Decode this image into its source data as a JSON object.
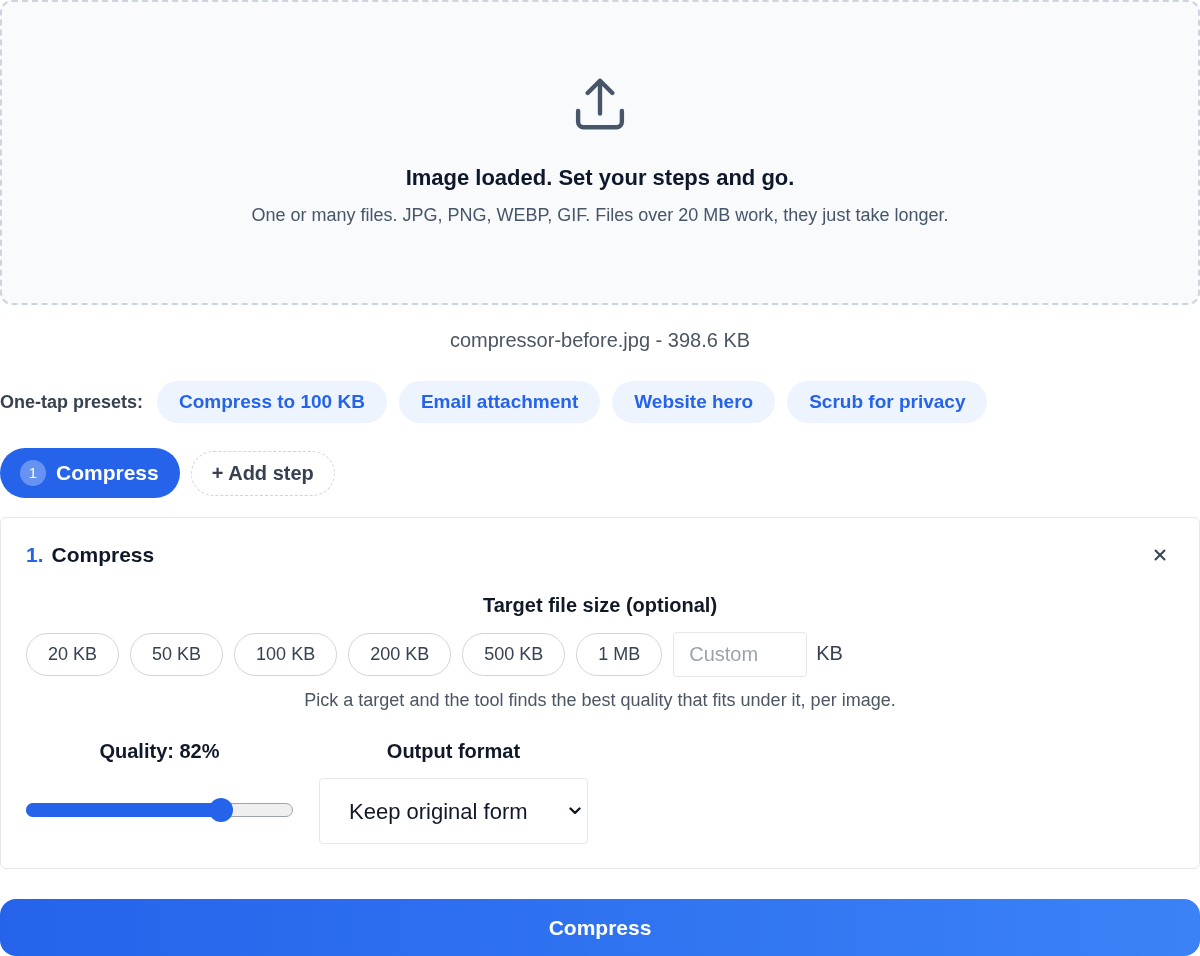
{
  "dropzone": {
    "title": "Image loaded. Set your steps and go.",
    "subtitle": "One or many files. JPG, PNG, WEBP, GIF. Files over 20 MB work, they just take longer."
  },
  "file_info": "compressor-before.jpg - 398.6 KB",
  "presets": {
    "label": "One-tap presets:",
    "items": [
      "Compress to 100 KB",
      "Email attachment",
      "Website hero",
      "Scrub for privacy"
    ]
  },
  "steps": {
    "items": [
      {
        "number": "1",
        "label": "Compress",
        "selected": true
      }
    ],
    "add_button": "+ Add step"
  },
  "step_card": {
    "number": "1.",
    "title": "Compress",
    "target": {
      "label": "Target file size (optional)",
      "options": [
        {
          "label": "20 KB",
          "selected": false
        },
        {
          "label": "50 KB",
          "selected": false
        },
        {
          "label": "100 KB",
          "selected": false
        },
        {
          "label": "200 KB",
          "selected": false
        },
        {
          "label": "500 KB",
          "selected": false
        },
        {
          "label": "1 MB",
          "selected": false
        }
      ],
      "custom": {
        "placeholder": "Custom"
      },
      "unit": "KB",
      "hint": "Pick a target and the tool finds the best quality that fits under it, per image."
    },
    "quality": {
      "label": "Quality: 82%",
      "level": 0.73
    },
    "format": {
      "label": "Output format",
      "value": "Keep original form"
    }
  },
  "submit_button": "Compress"
}
